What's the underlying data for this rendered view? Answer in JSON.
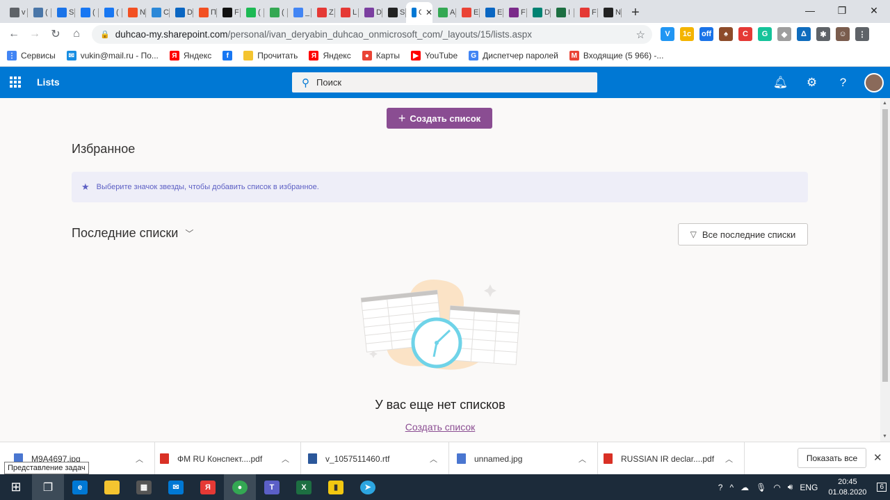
{
  "browser": {
    "tabs": [
      {
        "letter": "v",
        "color": "#5f6368"
      },
      {
        "letter": "(",
        "color": "#4a76a8"
      },
      {
        "letter": "S",
        "color": "#1a73e8"
      },
      {
        "letter": "(",
        "color": "#1877f2"
      },
      {
        "letter": "(",
        "color": "#1877f2"
      },
      {
        "letter": "N",
        "color": "#f25022"
      },
      {
        "letter": "C",
        "color": "#2b88d8"
      },
      {
        "letter": "D",
        "color": "#0a66c2"
      },
      {
        "letter": "П",
        "color": "#f25022"
      },
      {
        "letter": "F",
        "color": "#111111"
      },
      {
        "letter": "(",
        "color": "#1db954"
      },
      {
        "letter": "(",
        "color": "#34a853"
      },
      {
        "letter": "_",
        "color": "#4285f4"
      },
      {
        "letter": "Z",
        "color": "#e53935"
      },
      {
        "letter": "L",
        "color": "#e53935"
      },
      {
        "letter": "D",
        "color": "#7b3fa0"
      },
      {
        "letter": "S",
        "color": "#222222"
      }
    ],
    "active_tab": {
      "letter": "C",
      "close": "✕"
    },
    "tabs_after": [
      {
        "letter": "A",
        "color": "#34a853"
      },
      {
        "letter": "E",
        "color": "#ea4335"
      },
      {
        "letter": "E",
        "color": "#0a66c2"
      },
      {
        "letter": "F",
        "color": "#7b2a8a"
      },
      {
        "letter": "D",
        "color": "#008272"
      },
      {
        "letter": "I",
        "color": "#1d6f42"
      },
      {
        "letter": "F",
        "color": "#e53935"
      },
      {
        "letter": "N",
        "color": "#222222"
      }
    ],
    "new_tab": "+",
    "window_controls": {
      "minimize": "—",
      "maximize": "❐",
      "close": "✕"
    },
    "url_host": "duhcao-my.sharepoint.com",
    "url_path": "/personal/ivan_deryabin_duhcao_onmicrosoft_com/_layouts/15/lists.aspx",
    "extensions": [
      {
        "glyph": "V",
        "color": "#2196f3"
      },
      {
        "glyph": "1c",
        "color": "#f4b400"
      },
      {
        "glyph": "off",
        "color": "#1a73e8"
      },
      {
        "glyph": "♠",
        "color": "#8d4b2a"
      },
      {
        "glyph": "C",
        "color": "#e53935"
      },
      {
        "glyph": "G",
        "color": "#15c39a"
      },
      {
        "glyph": "◆",
        "color": "#9e9e9e"
      },
      {
        "glyph": "Δ",
        "color": "#0f6cbd"
      },
      {
        "glyph": "✱",
        "color": "#5f6368"
      },
      {
        "glyph": "☺",
        "color": "#7a5c4d"
      },
      {
        "glyph": "⋮",
        "color": "#5f6368"
      }
    ],
    "bookmarks": [
      {
        "label": "Сервисы",
        "icon": "apps-icon",
        "color": "#4285f4",
        "glyph": "⋮"
      },
      {
        "label": "vukin@mail.ru - По...",
        "icon": "mail-icon",
        "color": "#168de2",
        "glyph": "✉"
      },
      {
        "label": "Яндекс",
        "icon": "yandex-icon",
        "color": "#ff0000",
        "glyph": "Я"
      },
      {
        "label": "",
        "icon": "facebook-icon",
        "color": "#1877f2",
        "glyph": "f"
      },
      {
        "label": "Прочитать",
        "icon": "folder-icon",
        "color": "#f4c430",
        "glyph": ""
      },
      {
        "label": "Яндекс",
        "icon": "yandex-icon",
        "color": "#ff0000",
        "glyph": "Я"
      },
      {
        "label": "Карты",
        "icon": "map-pin-icon",
        "color": "#ea4335",
        "glyph": "●"
      },
      {
        "label": "YouTube",
        "icon": "youtube-icon",
        "color": "#ff0000",
        "glyph": "▶"
      },
      {
        "label": "Диспетчер паролей",
        "icon": "google-icon",
        "color": "#4285f4",
        "glyph": "G"
      },
      {
        "label": "Входящие (5 966) -...",
        "icon": "gmail-icon",
        "color": "#ea4335",
        "glyph": "M"
      }
    ]
  },
  "suite": {
    "app_title": "Lists",
    "search_placeholder": "Поиск"
  },
  "main": {
    "create_button": "Создать список",
    "favorites_heading": "Избранное",
    "favorites_hint": "Выберите значок звезды, чтобы добавить список в избранное.",
    "recent_heading": "Последние списки",
    "filter_button": "Все последние списки",
    "empty_title": "У вас еще нет списков",
    "empty_link": "Создать список"
  },
  "downloads": {
    "items": [
      {
        "name": "M9A4697.jpg",
        "type": "jpg"
      },
      {
        "name": "ФМ RU Конспект....pdf",
        "type": "pdf"
      },
      {
        "name": "v_1057511460.rtf",
        "type": "rtf"
      },
      {
        "name": "unnamed.jpg",
        "type": "jpg"
      },
      {
        "name": "RUSSIAN IR declar....pdf",
        "type": "pdf"
      }
    ],
    "show_all": "Показать все"
  },
  "taskbar": {
    "tooltip": "Представление задач",
    "lang": "ENG",
    "time": "20:45",
    "date": "01.08.2020",
    "notifications": "6"
  },
  "colors": {
    "suite_bar": "#0078d4",
    "accent": "#8a4d92",
    "favorites_bg": "#eeeef8"
  }
}
